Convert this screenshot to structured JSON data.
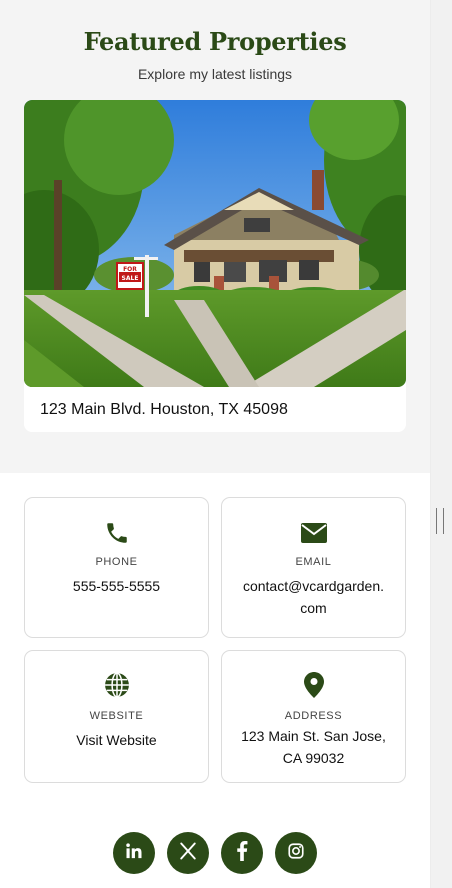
{
  "featured": {
    "title": "Featured Properties",
    "subtitle": "Explore my latest listings",
    "property": {
      "address": "123 Main Blvd. Houston, TX 45098",
      "sign_text_top": "FOR",
      "sign_text_bottom": "SALE"
    }
  },
  "contact": {
    "phone": {
      "label": "PHONE",
      "value": "555-555-5555",
      "icon": "phone-icon"
    },
    "email": {
      "label": "EMAIL",
      "value_line1": "contact@vcardgarden.",
      "value_line2": "com",
      "icon": "envelope-icon"
    },
    "website": {
      "label": "WEBSITE",
      "value": "Visit Website",
      "icon": "globe-icon"
    },
    "address": {
      "label": "ADDRESS",
      "value_line1": "123 Main St. San Jose,",
      "value_line2": "CA 99032",
      "icon": "map-pin-icon"
    }
  },
  "social": [
    {
      "name": "linkedin",
      "icon": "linkedin-icon"
    },
    {
      "name": "x",
      "icon": "x-icon"
    },
    {
      "name": "facebook",
      "icon": "facebook-icon"
    },
    {
      "name": "instagram",
      "icon": "instagram-icon"
    }
  ],
  "colors": {
    "accent": "#2b4a17",
    "background": "#f4f4f4",
    "card_border": "#dcdcdc"
  }
}
